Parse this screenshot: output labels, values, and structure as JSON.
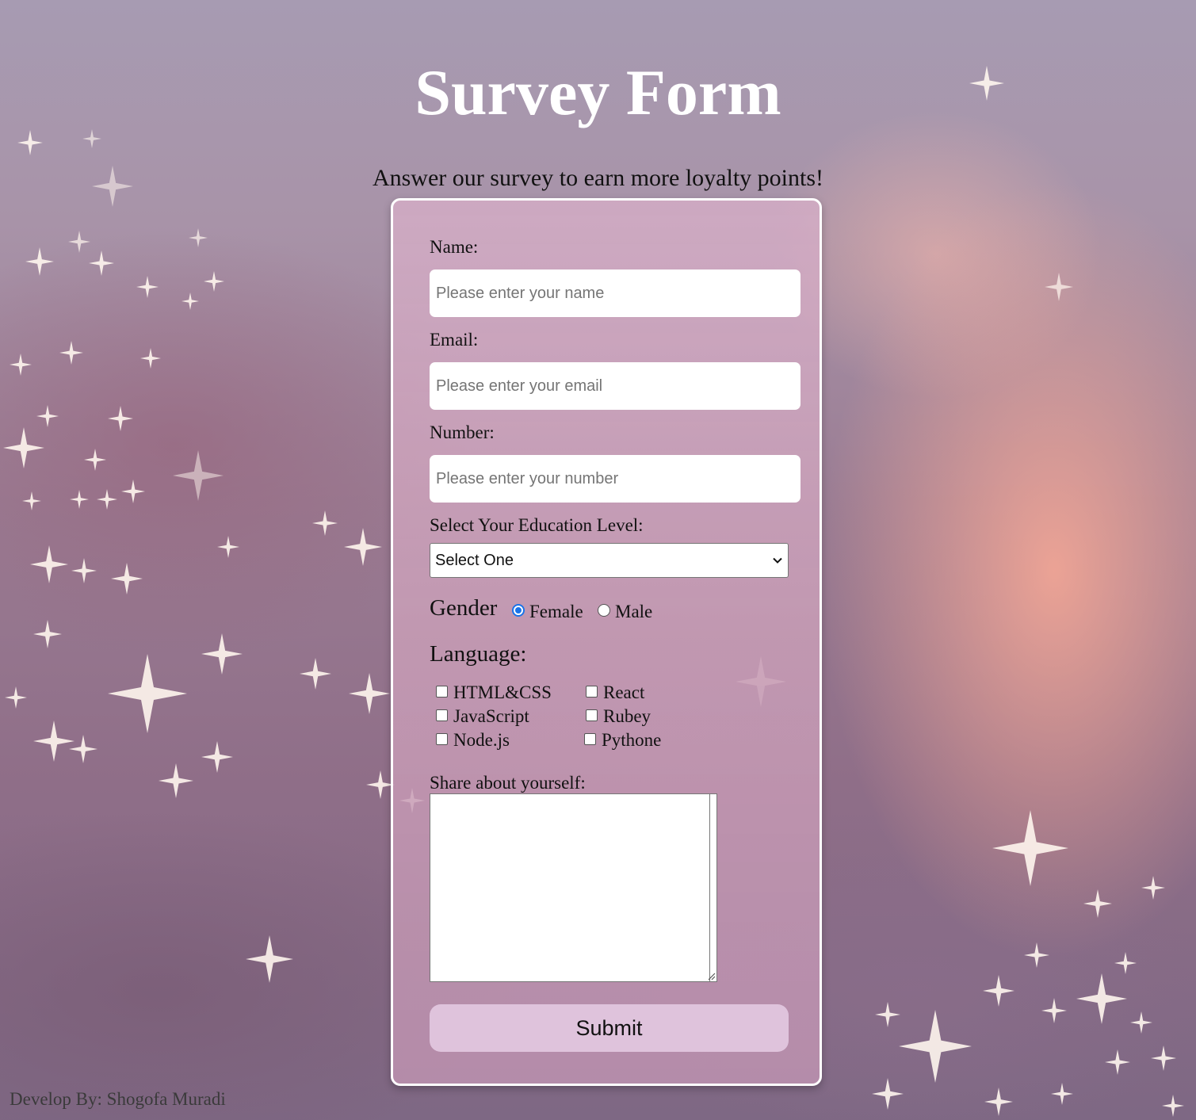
{
  "page": {
    "title": "Survey Form",
    "subtitle": "Answer our survey to earn more loyalty points!",
    "footer": "Develop By: Shogofa Muradi"
  },
  "form": {
    "name": {
      "label": "Name:",
      "placeholder": "Please enter your name"
    },
    "email": {
      "label": "Email:",
      "placeholder": "Please enter your email"
    },
    "number": {
      "label": "Number:",
      "placeholder": "Please enter your number"
    },
    "education": {
      "label": "Select Your Education Level:",
      "selected": "Select One"
    },
    "gender": {
      "label": "Gender",
      "options": [
        {
          "label": "Female",
          "checked": true
        },
        {
          "label": "Male",
          "checked": false
        }
      ]
    },
    "language": {
      "label": "Language:",
      "options": [
        {
          "label": "HTML&CSS",
          "checked": false
        },
        {
          "label": "React",
          "checked": false
        },
        {
          "label": "JavaScript",
          "checked": false
        },
        {
          "label": "Rubey",
          "checked": false
        },
        {
          "label": "Node.js",
          "checked": false
        },
        {
          "label": "Pythone",
          "checked": false
        }
      ]
    },
    "about": {
      "label": "Share about yourself:",
      "value": ""
    },
    "submit_label": "Submit"
  },
  "colors": {
    "title": "#ffffff",
    "card_border": "#ffffff",
    "submit_bg": "#dfc3dc",
    "radio_accent": "#1a73e8"
  }
}
